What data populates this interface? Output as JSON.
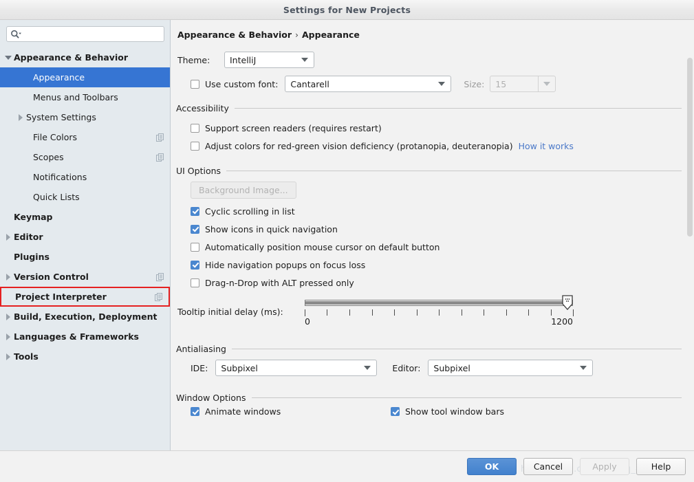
{
  "window": {
    "title": "Settings for New Projects"
  },
  "sidebar": {
    "search": {
      "value": "",
      "placeholder": ""
    },
    "items": [
      {
        "label": "Appearance & Behavior",
        "level": 0,
        "bold": true,
        "twisty": "down",
        "selected": false,
        "copy_icon": false,
        "highlighted": false
      },
      {
        "label": "Appearance",
        "level": 2,
        "bold": false,
        "twisty": "none",
        "selected": true,
        "copy_icon": false,
        "highlighted": false
      },
      {
        "label": "Menus and Toolbars",
        "level": 2,
        "bold": false,
        "twisty": "none",
        "selected": false,
        "copy_icon": false,
        "highlighted": false
      },
      {
        "label": "System Settings",
        "level": 1,
        "bold": false,
        "twisty": "right",
        "selected": false,
        "copy_icon": false,
        "highlighted": false
      },
      {
        "label": "File Colors",
        "level": 2,
        "bold": false,
        "twisty": "none",
        "selected": false,
        "copy_icon": true,
        "highlighted": false
      },
      {
        "label": "Scopes",
        "level": 2,
        "bold": false,
        "twisty": "none",
        "selected": false,
        "copy_icon": true,
        "highlighted": false
      },
      {
        "label": "Notifications",
        "level": 2,
        "bold": false,
        "twisty": "none",
        "selected": false,
        "copy_icon": false,
        "highlighted": false
      },
      {
        "label": "Quick Lists",
        "level": 2,
        "bold": false,
        "twisty": "none",
        "selected": false,
        "copy_icon": false,
        "highlighted": false
      },
      {
        "label": "Keymap",
        "level": 0,
        "bold": true,
        "twisty": "none",
        "selected": false,
        "copy_icon": false,
        "highlighted": false
      },
      {
        "label": "Editor",
        "level": 0,
        "bold": true,
        "twisty": "right",
        "selected": false,
        "copy_icon": false,
        "highlighted": false
      },
      {
        "label": "Plugins",
        "level": 0,
        "bold": true,
        "twisty": "none",
        "selected": false,
        "copy_icon": false,
        "highlighted": false
      },
      {
        "label": "Version Control",
        "level": 0,
        "bold": true,
        "twisty": "right",
        "selected": false,
        "copy_icon": true,
        "highlighted": false
      },
      {
        "label": "Project Interpreter",
        "level": 0,
        "bold": true,
        "twisty": "none",
        "selected": false,
        "copy_icon": true,
        "highlighted": true
      },
      {
        "label": "Build, Execution, Deployment",
        "level": 0,
        "bold": true,
        "twisty": "right",
        "selected": false,
        "copy_icon": false,
        "highlighted": false
      },
      {
        "label": "Languages & Frameworks",
        "level": 0,
        "bold": true,
        "twisty": "right",
        "selected": false,
        "copy_icon": false,
        "highlighted": false
      },
      {
        "label": "Tools",
        "level": 0,
        "bold": true,
        "twisty": "right",
        "selected": false,
        "copy_icon": false,
        "highlighted": false
      }
    ]
  },
  "breadcrumb": {
    "root": "Appearance & Behavior",
    "separator": "›",
    "leaf": "Appearance"
  },
  "appearance": {
    "theme_label": "Theme:",
    "theme_value": "IntelliJ",
    "custom_font_label": "Use custom font:",
    "custom_font_checked": false,
    "custom_font_value": "Cantarell",
    "size_label": "Size:",
    "size_value": "15"
  },
  "accessibility": {
    "title": "Accessibility",
    "options": [
      {
        "label": "Support screen readers (requires restart)",
        "checked": false
      },
      {
        "label": "Adjust colors for red-green vision deficiency (protanopia, deuteranopia)",
        "checked": false
      }
    ],
    "how_it_works_link": "How it works"
  },
  "ui_options": {
    "title": "UI Options",
    "background_image_button": "Background Image...",
    "options": [
      {
        "label": "Cyclic scrolling in list",
        "checked": true
      },
      {
        "label": "Show icons in quick navigation",
        "checked": true
      },
      {
        "label": "Automatically position mouse cursor on default button",
        "checked": false
      },
      {
        "label": "Hide navigation popups on focus loss",
        "checked": true
      },
      {
        "label": "Drag-n-Drop with ALT pressed only",
        "checked": false
      }
    ],
    "tooltip_delay_label": "Tooltip initial delay (ms):",
    "tooltip_delay_min": "0",
    "tooltip_delay_max": "1200",
    "tooltip_delay_value": "1200",
    "tooltip_tick_count": 13
  },
  "antialiasing": {
    "title": "Antialiasing",
    "ide_label": "IDE:",
    "ide_value": "Subpixel",
    "editor_label": "Editor:",
    "editor_value": "Subpixel"
  },
  "window_options": {
    "title": "Window Options",
    "animate_windows_label": "Animate windows",
    "animate_windows_checked": true,
    "show_tool_window_bars_label": "Show tool window bars",
    "show_tool_window_bars_checked": true
  },
  "footer": {
    "ok": "OK",
    "cancel": "Cancel",
    "apply": "Apply",
    "help": "Help"
  },
  "watermark": {
    "text": "https://blog.csdn.net/qq_43317369"
  },
  "colors": {
    "accent": "#3675d3",
    "checkbox_checked": "#4a87cf",
    "highlight_border": "#e52020",
    "link": "#4a78c8",
    "sidebar_bg": "#e4eaee",
    "content_bg": "#f2f2f2"
  }
}
